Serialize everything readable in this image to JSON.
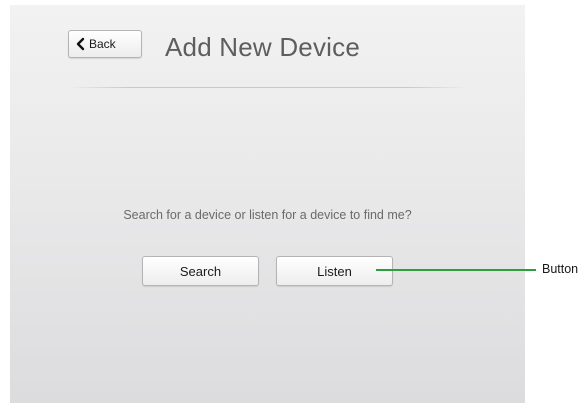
{
  "header": {
    "back_label": "Back",
    "title": "Add New Device"
  },
  "main": {
    "prompt": "Search for a device or listen for a device to find me?",
    "search_label": "Search",
    "listen_label": "Listen"
  },
  "annotation": {
    "label": "Button",
    "line_color": "#2e9e3c"
  },
  "icons": {
    "back": "chevron-left-icon"
  }
}
